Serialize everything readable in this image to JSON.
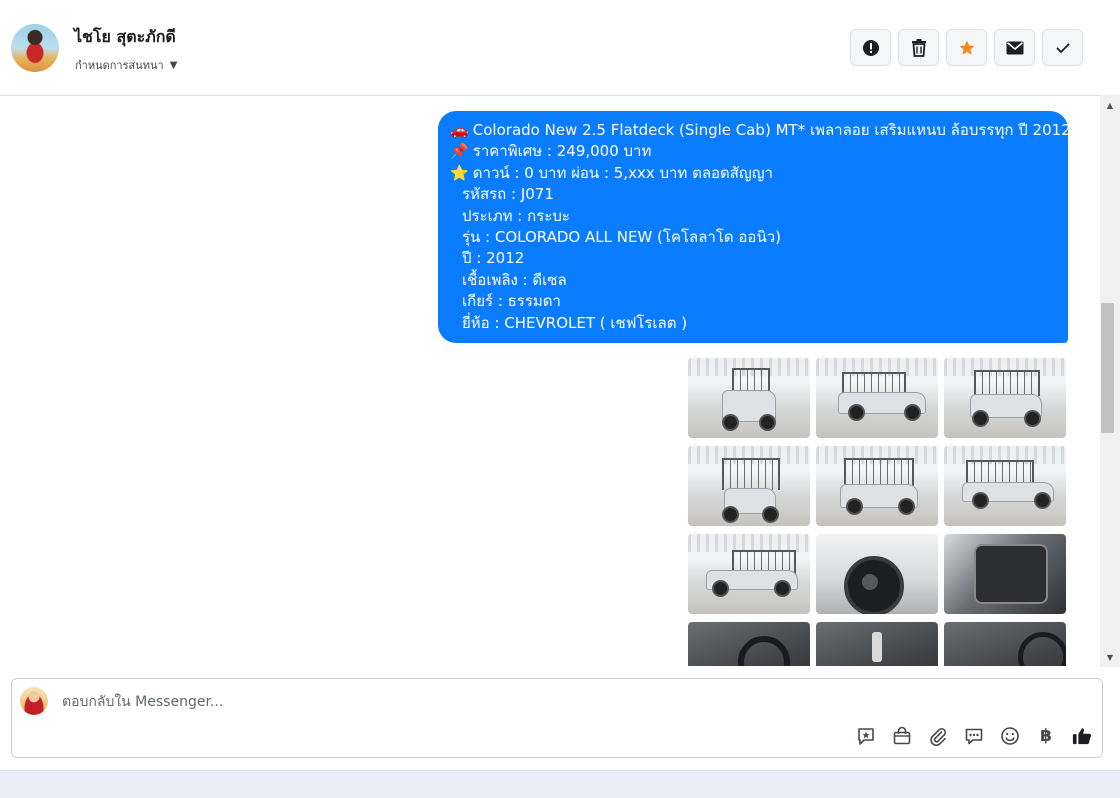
{
  "header": {
    "contact_name": "ไชโย สุตะภักดี",
    "conversation_settings_label": "กำหนดการสนทนา",
    "actions": [
      "spam",
      "delete",
      "star",
      "mark-unread",
      "done"
    ],
    "star_color": "#f08a24"
  },
  "message": {
    "bubble_color": "#0a7cff",
    "lines": [
      "Colorado New 2.5 Flatdeck (Single Cab) MT* เพลาลอย เสริมแหนบ ล้อบรรทุก  ปี 2012",
      "ราคาพิเศษ : 249,000 บาท",
      "ดาวน์ : 0 บาท ผ่อน : 5,xxx บาท ตลอดสัญญา",
      "รหัสรถ : J071",
      "ประเภท : กระบะ",
      "รุ่น : COLORADO ALL NEW (โคโลลาโด ออนิว)",
      "ปี : 2012",
      "เชื้อเพลิง : ดีเซล",
      "เกียร์ : ธรรมดา",
      "ยี่ห้อ : CHEVROLET ( เชฟโรเลต )"
    ],
    "emojis": [
      "🚗",
      "📌",
      "⭐"
    ],
    "photos": [
      "truck-front",
      "truck-rear-quarter",
      "truck-rear",
      "truck-rear-close",
      "truck-front-quarter",
      "truck-side-rear",
      "truck-side",
      "truck-wheel",
      "truck-door",
      "truck-dashboard",
      "truck-gearshift",
      "truck-seat"
    ]
  },
  "composer": {
    "placeholder": "ตอบกลับใน Messenger...",
    "tools": [
      "saved-reply-icon",
      "shop-icon",
      "attach-icon",
      "chat-bubble-icon",
      "emoji-icon",
      "baht-icon",
      "thumbs-up-icon"
    ],
    "baht_symbol": "฿"
  }
}
